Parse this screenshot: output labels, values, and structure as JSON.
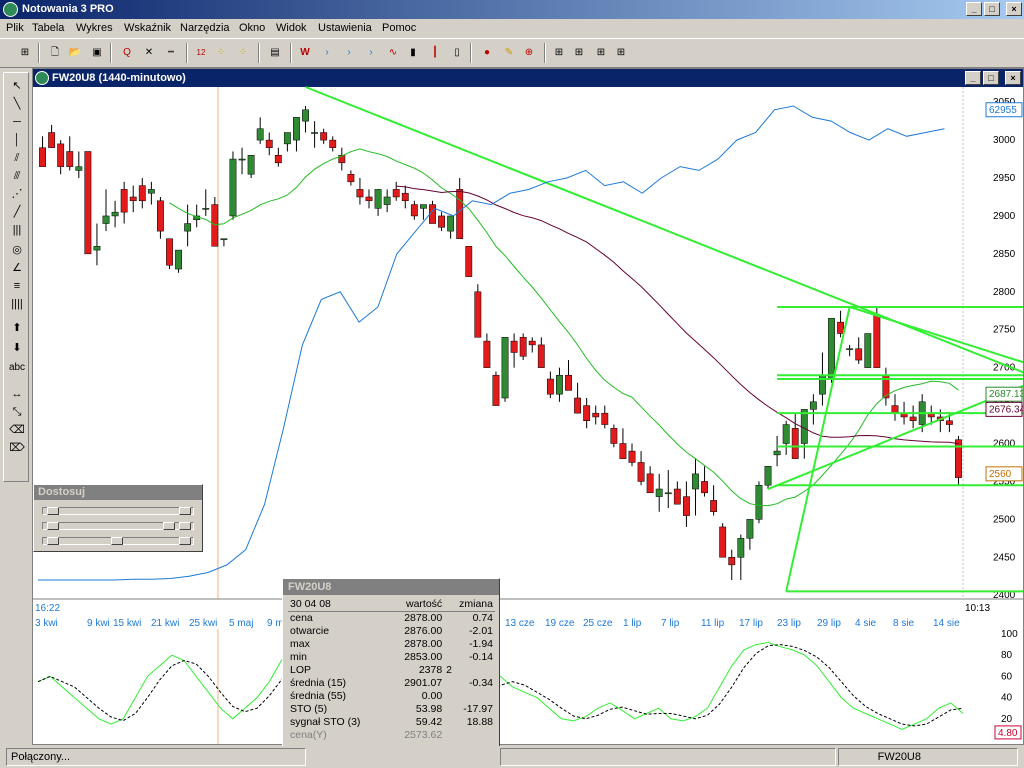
{
  "app": {
    "title": "Notowania 3 PRO"
  },
  "menu": [
    "Plik",
    "Tabela",
    "Wykres",
    "Wskaźnik",
    "Narzędzia",
    "Okno",
    "Widok",
    "Ustawienia",
    "Pomoc"
  ],
  "toolbar": {
    "icons": [
      "grid-icon",
      "new-icon",
      "open-icon",
      "save-icon",
      "search-icon",
      "delete-icon",
      "ruler-icon",
      "numbers-icon",
      "indicator-icon",
      "indicator2-icon",
      "add-indicator-icon",
      "wl-icon",
      "arrow-blue-icon",
      "arrow-blue2-icon",
      "line-chart-icon",
      "bar-chart-icon",
      "ohlc-icon",
      "candle-icon",
      "signal-icon",
      "pin-icon",
      "zoom-icon",
      "layout1-icon",
      "layout2-icon",
      "layout3-icon",
      "layout4-icon"
    ]
  },
  "left_tools": {
    "text_tool": "abc"
  },
  "chart_window": {
    "title": "FW20U8 (1440-minutowo)"
  },
  "dostosuj": {
    "title": "Dostosuj"
  },
  "chart_data": {
    "type": "candlestick",
    "symbol": "FW20U8",
    "y_ticks": [
      3050,
      3000,
      2950,
      2900,
      2850,
      2800,
      2750,
      2700,
      2650,
      2600,
      2550,
      2500,
      2450,
      2400
    ],
    "ylim": [
      2395,
      3070
    ],
    "last_price_label": "2560",
    "right_labels": [
      "62955",
      "2687.13",
      "2676.34"
    ],
    "time_left": "16:22",
    "time_right": "10:13",
    "x_labels": [
      "3 kwi",
      "9 kwi",
      "15 kwi",
      "21 kwi",
      "25 kwi",
      "5 maj",
      "9 m",
      "13 cze",
      "19 cze",
      "25 cze",
      "1 lip",
      "7 lip",
      "11 lip",
      "17 lip",
      "23 lip",
      "29 lip",
      "4 sie",
      "8 sie",
      "14 sie"
    ],
    "candles": [
      [
        2990,
        3005,
        2975,
        2965
      ],
      [
        3010,
        3020,
        2995,
        2990
      ],
      [
        2995,
        3000,
        2955,
        2965
      ],
      [
        2985,
        3005,
        2960,
        2965
      ],
      [
        2960,
        2985,
        2950,
        2965
      ],
      [
        2985,
        2985,
        2850,
        2850
      ],
      [
        2855,
        2890,
        2835,
        2860
      ],
      [
        2890,
        2935,
        2880,
        2900
      ],
      [
        2900,
        2920,
        2885,
        2905
      ],
      [
        2935,
        2945,
        2890,
        2905
      ],
      [
        2925,
        2940,
        2905,
        2920
      ],
      [
        2940,
        2950,
        2910,
        2920
      ],
      [
        2930,
        2945,
        2915,
        2935
      ],
      [
        2920,
        2925,
        2870,
        2880
      ],
      [
        2870,
        2870,
        2830,
        2835
      ],
      [
        2830,
        2855,
        2825,
        2855
      ],
      [
        2880,
        2915,
        2860,
        2890
      ],
      [
        2895,
        2915,
        2885,
        2900
      ],
      [
        2910,
        2935,
        2900,
        2910
      ],
      [
        2915,
        2925,
        2875,
        2860
      ],
      [
        2870,
        2870,
        2860,
        2870
      ],
      [
        2900,
        2985,
        2895,
        2975
      ],
      [
        2975,
        2990,
        2955,
        2975
      ],
      [
        2955,
        2980,
        2950,
        2980
      ],
      [
        3000,
        3030,
        2995,
        3015
      ],
      [
        3000,
        3010,
        2980,
        2990
      ],
      [
        2980,
        2990,
        2965,
        2970
      ],
      [
        2995,
        3000,
        2985,
        3010
      ],
      [
        3000,
        3020,
        2985,
        3030
      ],
      [
        3025,
        3045,
        3010,
        3040
      ],
      [
        3010,
        3025,
        2990,
        3010
      ],
      [
        3010,
        3015,
        2995,
        3000
      ],
      [
        3000,
        3005,
        2985,
        2990
      ],
      [
        2980,
        2990,
        2960,
        2970
      ],
      [
        2955,
        2960,
        2940,
        2945
      ],
      [
        2935,
        2950,
        2915,
        2925
      ],
      [
        2925,
        2935,
        2910,
        2920
      ],
      [
        2910,
        2925,
        2900,
        2935
      ],
      [
        2915,
        2935,
        2905,
        2925
      ],
      [
        2935,
        2945,
        2920,
        2925
      ],
      [
        2930,
        2940,
        2910,
        2920
      ],
      [
        2915,
        2920,
        2895,
        2900
      ],
      [
        2910,
        2915,
        2895,
        2915
      ],
      [
        2915,
        2920,
        2895,
        2890
      ],
      [
        2900,
        2905,
        2880,
        2885
      ],
      [
        2880,
        2895,
        2870,
        2900
      ],
      [
        2935,
        2950,
        2870,
        2870
      ],
      [
        2860,
        2860,
        2820,
        2820
      ],
      [
        2800,
        2810,
        2760,
        2740
      ],
      [
        2735,
        2745,
        2700,
        2700
      ],
      [
        2690,
        2695,
        2660,
        2650
      ],
      [
        2660,
        2700,
        2655,
        2740
      ],
      [
        2735,
        2745,
        2700,
        2720
      ],
      [
        2740,
        2745,
        2710,
        2715
      ],
      [
        2735,
        2740,
        2720,
        2730
      ],
      [
        2730,
        2740,
        2710,
        2700
      ],
      [
        2685,
        2695,
        2660,
        2665
      ],
      [
        2665,
        2700,
        2655,
        2690
      ],
      [
        2690,
        2710,
        2675,
        2670
      ],
      [
        2660,
        2680,
        2640,
        2640
      ],
      [
        2650,
        2660,
        2620,
        2630
      ],
      [
        2640,
        2650,
        2625,
        2635
      ],
      [
        2640,
        2650,
        2620,
        2625
      ],
      [
        2620,
        2625,
        2595,
        2600
      ],
      [
        2600,
        2620,
        2580,
        2580
      ],
      [
        2590,
        2600,
        2570,
        2575
      ],
      [
        2575,
        2590,
        2545,
        2550
      ],
      [
        2560,
        2570,
        2535,
        2535
      ],
      [
        2530,
        2560,
        2510,
        2540
      ],
      [
        2535,
        2565,
        2515,
        2535
      ],
      [
        2540,
        2550,
        2525,
        2520
      ],
      [
        2530,
        2550,
        2490,
        2505
      ],
      [
        2540,
        2580,
        2505,
        2560
      ],
      [
        2550,
        2570,
        2530,
        2535
      ],
      [
        2525,
        2545,
        2505,
        2510
      ],
      [
        2490,
        2495,
        2455,
        2450
      ],
      [
        2450,
        2460,
        2420,
        2440
      ],
      [
        2450,
        2480,
        2420,
        2475
      ],
      [
        2475,
        2500,
        2460,
        2500
      ],
      [
        2500,
        2550,
        2495,
        2545
      ],
      [
        2545,
        2570,
        2540,
        2570
      ],
      [
        2585,
        2610,
        2570,
        2590
      ],
      [
        2600,
        2630,
        2585,
        2625
      ],
      [
        2620,
        2640,
        2585,
        2580
      ],
      [
        2600,
        2635,
        2580,
        2645
      ],
      [
        2645,
        2665,
        2625,
        2655
      ],
      [
        2665,
        2720,
        2650,
        2690
      ],
      [
        2685,
        2765,
        2680,
        2765
      ],
      [
        2760,
        2775,
        2740,
        2745
      ],
      [
        2725,
        2730,
        2715,
        2725
      ],
      [
        2725,
        2740,
        2705,
        2710
      ],
      [
        2700,
        2745,
        2700,
        2745
      ],
      [
        2770,
        2780,
        2700,
        2700
      ],
      [
        2690,
        2700,
        2650,
        2660
      ],
      [
        2650,
        2665,
        2630,
        2640
      ],
      [
        2640,
        2655,
        2625,
        2635
      ],
      [
        2635,
        2650,
        2620,
        2630
      ],
      [
        2625,
        2665,
        2615,
        2655
      ],
      [
        2640,
        2650,
        2625,
        2635
      ],
      [
        2635,
        2645,
        2615,
        2630
      ],
      [
        2630,
        2640,
        2615,
        2625
      ],
      [
        2605,
        2610,
        2545,
        2555
      ]
    ],
    "sto_ticks": [
      100,
      80,
      60,
      40,
      20
    ],
    "sto_last_label": "4.80",
    "info": {
      "title": "FW20U8",
      "date": "30 04 08",
      "col_value": "wartość",
      "col_change": "zmiana",
      "rows": [
        {
          "label": "cena",
          "value": "2878.00",
          "change": "0.74"
        },
        {
          "label": "otwarcie",
          "value": "2876.00",
          "change": "-2.01"
        },
        {
          "label": "max",
          "value": "2878.00",
          "change": "-1.94"
        },
        {
          "label": "min",
          "value": "2853.00",
          "change": "-0.14"
        },
        {
          "label": "LOP",
          "value": "2378",
          "change": "2"
        },
        {
          "label": "średnia (15)",
          "value": "2901.07",
          "change": "-0.34"
        },
        {
          "label": "średnia (55)",
          "value": "0.00",
          "change": ""
        },
        {
          "label": "STO (5)",
          "value": "53.98",
          "change": "-17.97"
        },
        {
          "label": "sygnał STO (3)",
          "value": "59.42",
          "change": "18.88"
        },
        {
          "label": "cena(Y)",
          "value": "2573.62",
          "change": ""
        }
      ]
    }
  },
  "colors": {
    "up": "#2f8a33",
    "down": "#e11b1b",
    "trend": "#33ee33",
    "ma15": "#22bb22",
    "ma55": "#660033",
    "lop": "#1e7ad6"
  },
  "status": {
    "connection": "Połączony...",
    "symbol": "FW20U8"
  }
}
